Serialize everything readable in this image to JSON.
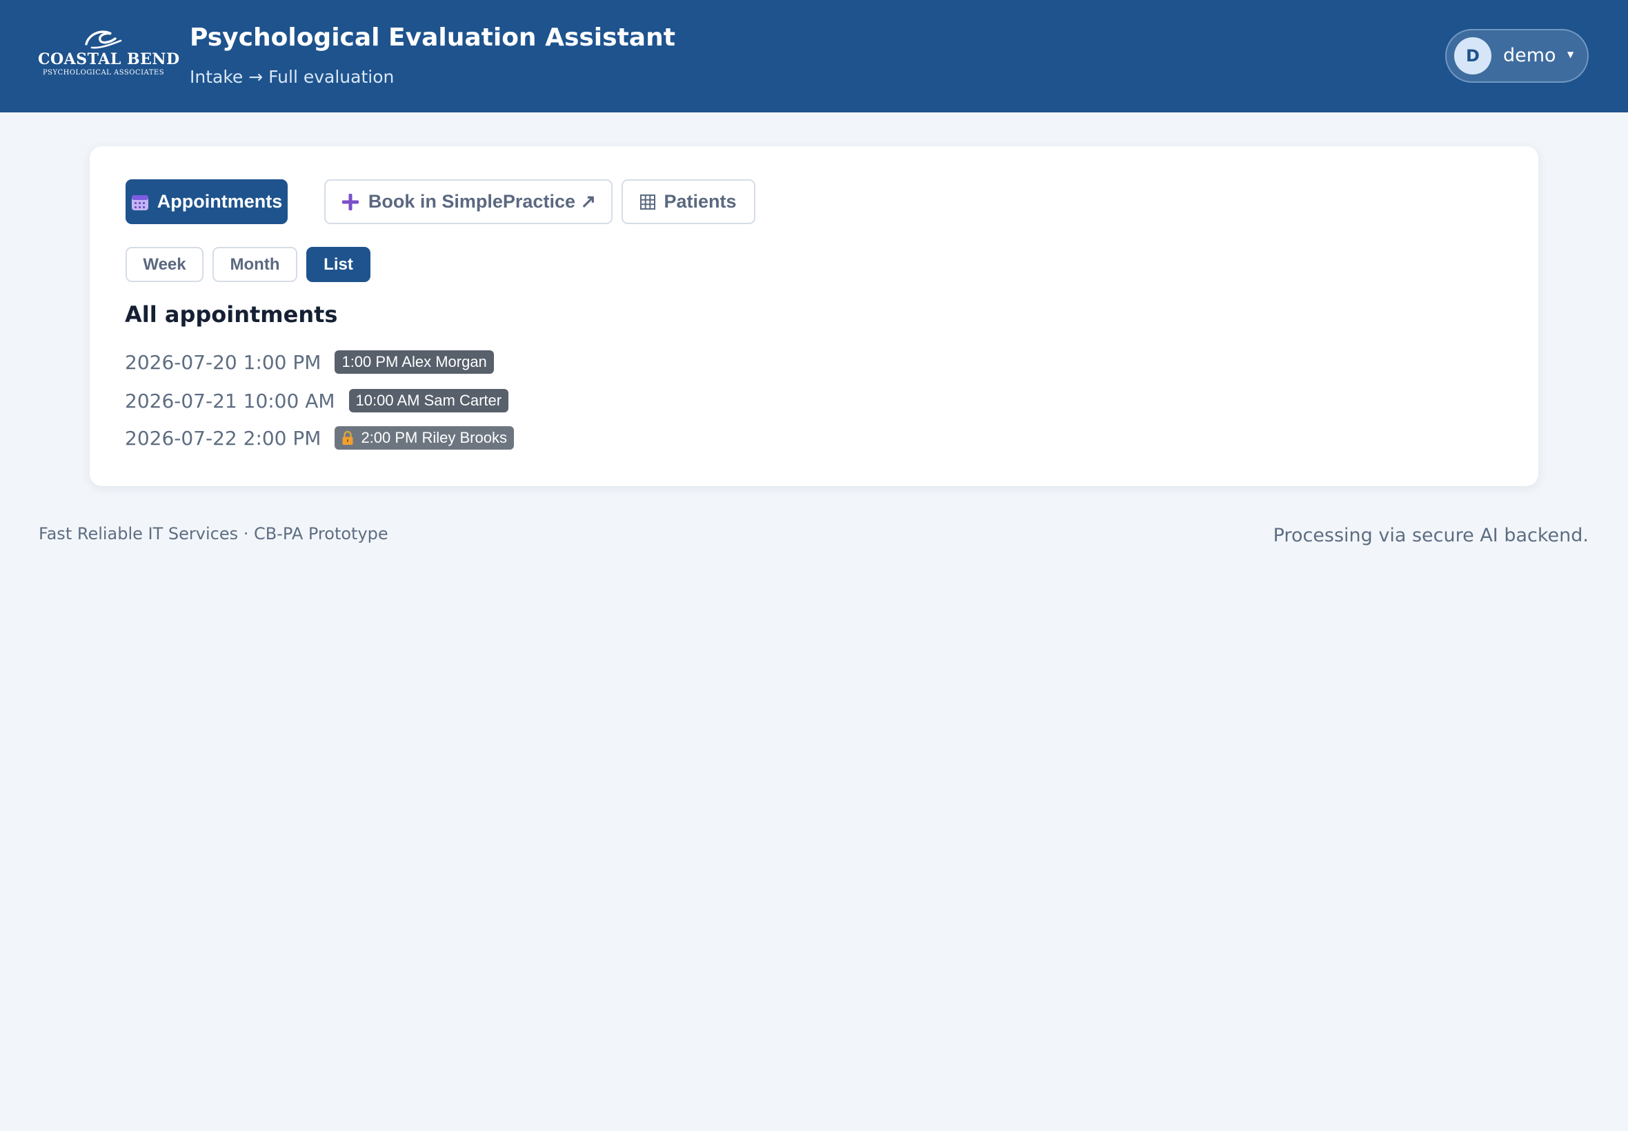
{
  "header": {
    "logo": {
      "name": "COASTAL BEND",
      "tagline": "PSYCHOLOGICAL ASSOCIATES"
    },
    "title": "Psychological Evaluation Assistant",
    "subtitle": "Intake → Full evaluation",
    "user": {
      "initial": "D",
      "name": "demo",
      "menu_icon": "caret-down-icon"
    }
  },
  "tabs": [
    {
      "label": "Appointments",
      "icon": "calendar-icon",
      "active": true
    },
    {
      "label": "Book in SimplePractice ↗",
      "icon": "plus-icon",
      "active": false
    },
    {
      "label": "Patients",
      "icon": "grid-icon",
      "active": false
    }
  ],
  "views": [
    {
      "label": "Week",
      "active": false
    },
    {
      "label": "Month",
      "active": false
    },
    {
      "label": "List",
      "active": true
    }
  ],
  "list": {
    "title": "All appointments",
    "items": [
      {
        "datetime": "2026-07-20 1:00 PM",
        "badge": "1:00 PM Alex Morgan",
        "locked": false
      },
      {
        "datetime": "2026-07-21 10:00 AM",
        "badge": "10:00 AM Sam Carter",
        "locked": false
      },
      {
        "datetime": "2026-07-22 2:00 PM",
        "badge": "2:00 PM Riley Brooks",
        "locked": true,
        "icon": "lock-icon"
      }
    ]
  },
  "footer": {
    "left": "Fast Reliable IT Services · CB-PA Prototype",
    "right": "Processing via secure AI backend."
  },
  "colors": {
    "header_bg": "#1e538d",
    "page_bg": "#f2f6fa",
    "active_button": "#1e538d",
    "badge": "#57606b",
    "plus_icon": "#7b4fc9",
    "lock_icon": "#f0a030"
  }
}
